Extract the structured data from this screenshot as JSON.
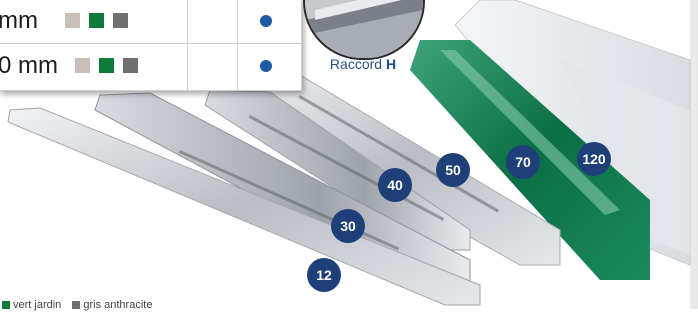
{
  "table": {
    "rows": [
      {
        "size": "mm",
        "dot_color": "#1f5aa6"
      },
      {
        "size": "0 mm",
        "dot_color": "#1f5aa6"
      }
    ],
    "swatches": [
      "#c9bfba",
      "#0f7a3a",
      "#6f6f6f"
    ]
  },
  "inset": {
    "caption_prefix": "Raccord ",
    "caption_bold": "H"
  },
  "profiles": [
    {
      "badge": "12"
    },
    {
      "badge": "30"
    },
    {
      "badge": "40"
    },
    {
      "badge": "50"
    },
    {
      "badge": "70"
    },
    {
      "badge": "120"
    }
  ],
  "colors": {
    "badge_bg": "#1f3f78",
    "green": "#0f7a3a",
    "aluminium": "#c7cacf"
  },
  "legend": {
    "green_label": "vert jardin",
    "gray_label": "gris anthracite"
  }
}
